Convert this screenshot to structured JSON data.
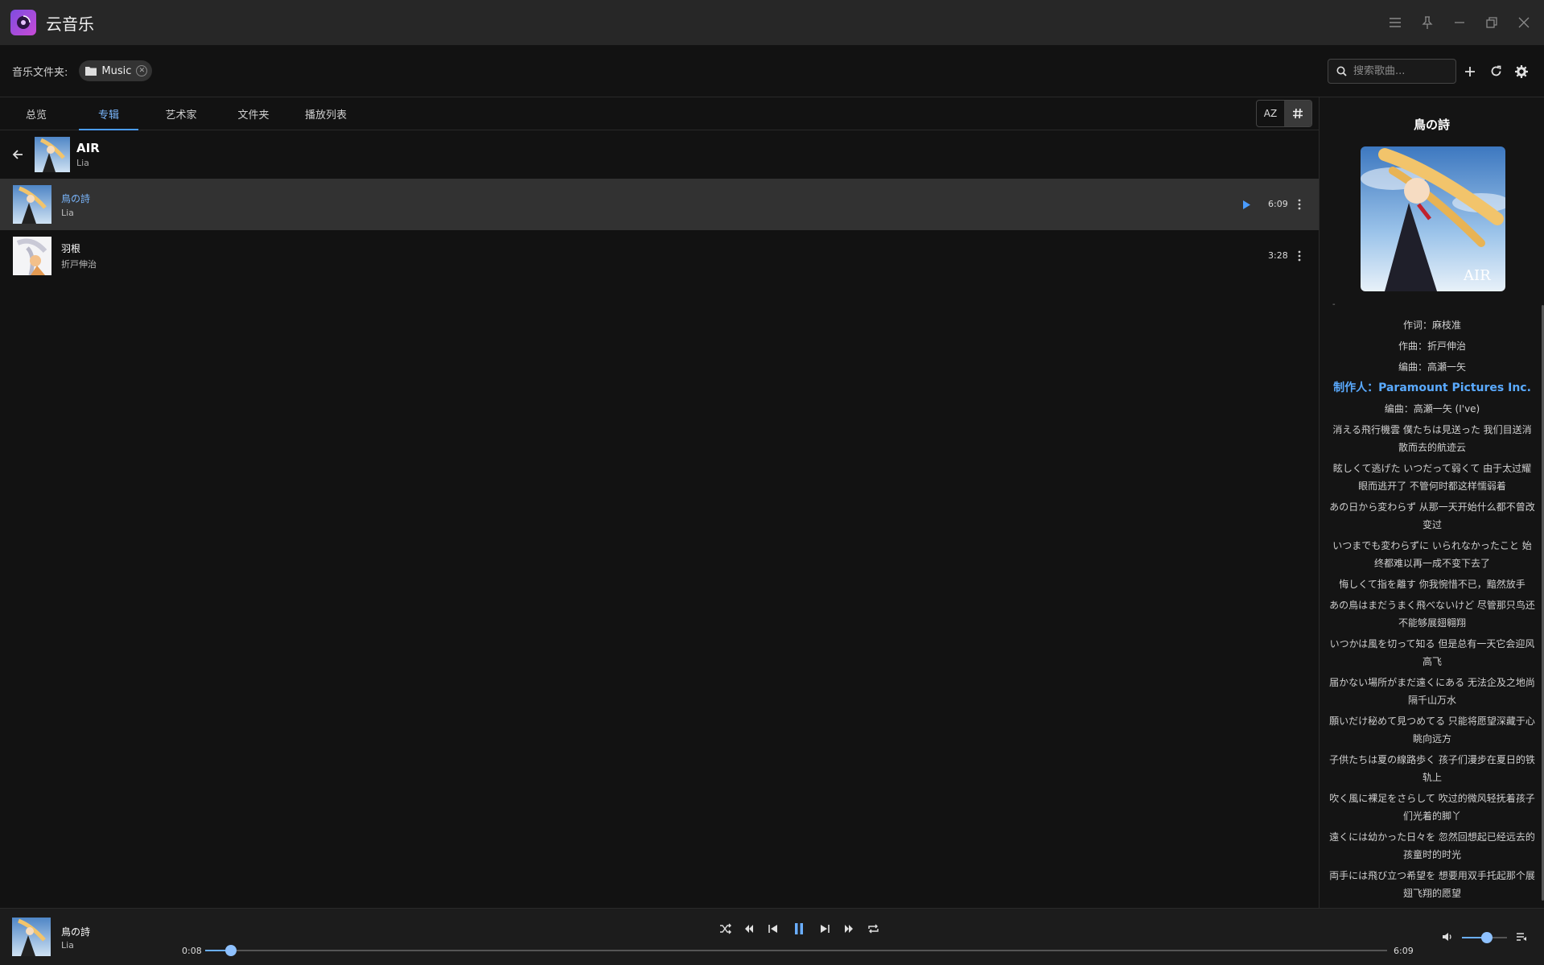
{
  "app": {
    "title": "云音乐"
  },
  "folderbar": {
    "label": "音乐文件夹:",
    "chip": "Music",
    "search_placeholder": "搜索歌曲..."
  },
  "tabs": [
    {
      "label": "总览",
      "active": false
    },
    {
      "label": "专辑",
      "active": true
    },
    {
      "label": "艺术家",
      "active": false
    },
    {
      "label": "文件夹",
      "active": false
    },
    {
      "label": "播放列表",
      "active": false
    }
  ],
  "sort": {
    "az": "AZ"
  },
  "album": {
    "title": "AIR",
    "artist": "Lia"
  },
  "tracks": [
    {
      "title": "鳥の詩",
      "artist": "Lia",
      "duration": "6:09",
      "playing": true
    },
    {
      "title": "羽根",
      "artist": "折戸伸治",
      "duration": "3:28",
      "playing": false
    }
  ],
  "lyrics": {
    "song_title": "鳥の詩",
    "cover_text": "AIR",
    "dot": "-",
    "lines": [
      "作词：麻枝准",
      "作曲：折戸伸治",
      "编曲：高瀬一矢",
      "制作人：Paramount Pictures Inc.",
      "编曲：高瀬一矢 (I've)",
      "消える飛行機雲 僕たちは見送った 我们目送消散而去的航迹云",
      "眩しくて逃げた いつだって弱くて 由于太过耀眼而逃开了 不管何时都这样懦弱着",
      "あの日から変わらず 从那一天开始什么都不曾改变过",
      "いつまでも変わらずに いられなかったこと 始终都难以再一成不变下去了",
      "悔しくて指を離す 你我惋惜不已，黯然放手",
      "あの鳥はまだうまく飛べないけど 尽管那只鸟还不能够展翅翱翔",
      "いつかは風を切って知る 但是总有一天它会迎风高飞",
      "届かない場所がまだ遠くにある 无法企及之地尚隔千山万水",
      "願いだけ秘めて見つめてる 只能将愿望深藏于心 眺向远方",
      "子供たちは夏の線路歩く 孩子们漫步在夏日的铁轨上",
      "吹く風に裸足をさらして 吹过的微风轻抚着孩子们光着的脚丫",
      "遠くには幼かった日々を 忽然回想起已经远去的孩童时的时光",
      "両手には飛び立つ希望を 想要用双手托起那个展翅飞翔的愿望"
    ],
    "current_index": 3
  },
  "player": {
    "title": "鳥の詩",
    "artist": "Lia",
    "time_current": "0:08",
    "time_total": "6:09",
    "progress": 0.022,
    "volume": 0.55
  },
  "colors": {
    "accent": "#4a9cff",
    "background": "#121212",
    "selected_row": "#323232"
  }
}
